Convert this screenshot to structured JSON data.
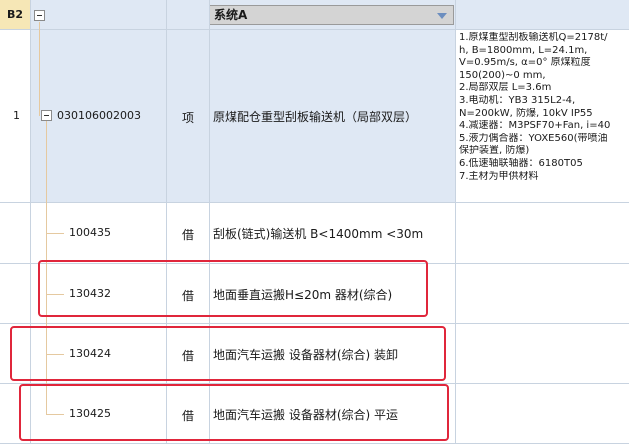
{
  "header": {
    "cell_ref": "B2",
    "system_dropdown": "系统A"
  },
  "rows": [
    {
      "row_num": "1",
      "code": "030106002003",
      "unit": "项",
      "name": "原煤配仓重型刮板输送机（局部双层）",
      "description": [
        "1.原煤重型刮板输送机Q=2178t/",
        "h, B=1800mm, L=24.1m,",
        "V=0.95m/s, α=0° 原煤粒度",
        "150(200)~0 mm,",
        "2.局部双层 L=3.6m",
        "3.电动机：YB3 315L2-4,",
        "N=200kW, 防爆, 10kV  IP55",
        "4.减速器：M3PSF70+Fan, i=40",
        "5.液力偶合器：YOXE560(带喷油",
        "保护装置, 防爆)",
        "6.低速轴联轴器：6180T05",
        "7.主材为甲供材料"
      ]
    },
    {
      "code": "100435",
      "unit": "借",
      "name": "刮板(链式)输送机 B<1400mm <30m"
    },
    {
      "code": "130432",
      "unit": "借",
      "name": "地面垂直运搬H≤20m 器材(综合)"
    },
    {
      "code": "130424",
      "unit": "借",
      "name": "地面汽车运搬 设备器材(综合) 装卸"
    },
    {
      "code": "130425",
      "unit": "借",
      "name": "地面汽车运搬 设备器材(综合) 平运"
    }
  ],
  "colors": {
    "header_bg": "#dfe8f4",
    "b2_bg": "#f6e7b6",
    "highlight_red": "#e0263b",
    "tree_line": "#e5c9a0"
  }
}
